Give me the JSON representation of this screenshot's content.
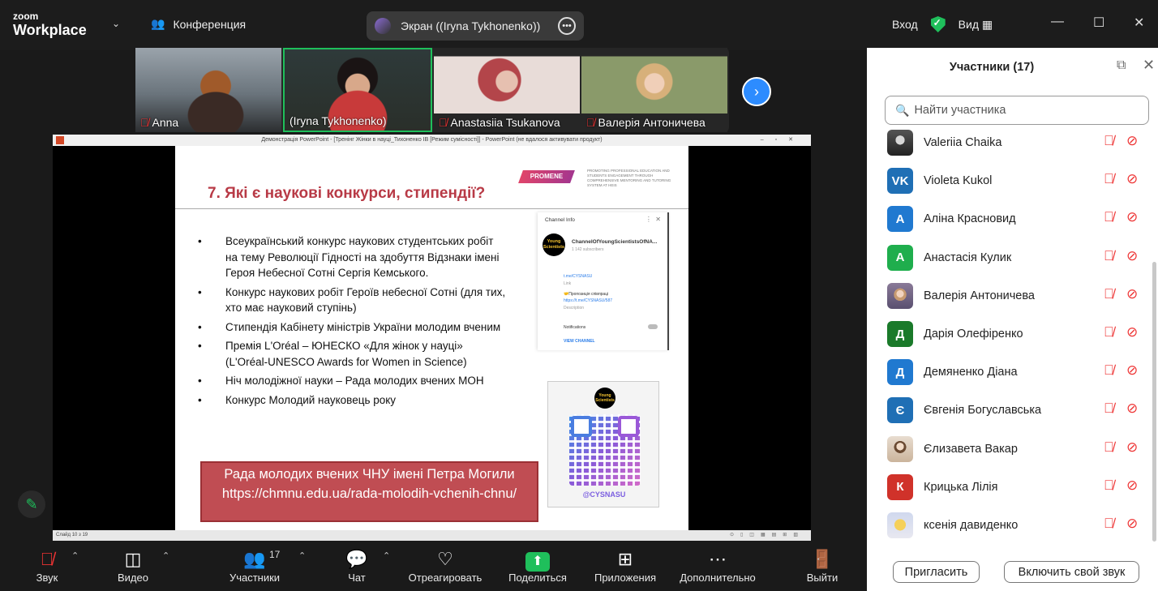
{
  "topbar": {
    "logo_line1": "zoom",
    "logo_line2": "Workplace",
    "meeting_label": "Конференция",
    "share_label": "Экран ((Iryna Tykhonenko))",
    "login_label": "Вход",
    "view_label": "Вид",
    "accent_green": "#1fbf5b"
  },
  "video_tiles": [
    {
      "name": "Anna",
      "muted": true
    },
    {
      "name": "(Iryna Tykhonenko)",
      "muted": false,
      "active": true
    },
    {
      "name": "Anastasiia Tsukanova",
      "muted": true
    },
    {
      "name": "Валерія Антоничева",
      "muted": true
    }
  ],
  "ppt": {
    "window_title": "Демонстрація PowerPoint - [Тренінг Жінки в науці_Тихоненко ІВ [Режим сумісності]] - PowerPoint (не вдалося активувати продукт)",
    "status_left": "Слайд 10 з 19",
    "slide_title": "7. Які є наукові конкурси, стипендії?",
    "logo_text": "PROMENE",
    "promo_text": "PROMOTING PROFESSIONAL EDUCATION AND STUDENTS ENGAGEMENT THROUGH COMPREHENSIVE MENTORING AND TUTORING SYSTEM AT HEIS",
    "bullets": [
      "Всеукраїнський конкурс наукових студентських робіт на тему Революції Гідності на здобуття Відзнаки імені Героя Небесної Сотні Сергія Кемського.",
      "Конкурс наукових робіт Героїв небесної Сотні (для тих, хто має науковий ступінь)",
      "Стипендія Кабінету міністрів України молодим вченим",
      "Премія L'Oréal – ЮНЕСКО «Для жінок у науці» (L'Oréal-UNESCO Awards for Women in Science)",
      "Ніч молодіжної науки – Рада молодих вчених МОН",
      "Конкурс Молодий науковець року"
    ],
    "rada_text": "Рада молодих вчених ЧНУ імені Петра Могили https://chmnu.edu.ua/rada-molodih-vchenih-chnu/",
    "channel": {
      "header": "Channel Info",
      "avatar_text": "Young Scientists",
      "name": "ChannelOfYoungScientistsOfNA...",
      "subscribers": "1 142 subscribers",
      "link": "t.me/CYSNASU",
      "link_label": "Link",
      "desc_line1": "🤝Пропозиція співпраці",
      "desc_line2": "https://t.me/CYSNASU/587",
      "desc_label": "Description",
      "notifications": "Notifications",
      "view_channel": "VIEW CHANNEL"
    },
    "qr_badge": "Young Scientists",
    "qr_caption": "@CYSNASU"
  },
  "toolbar": {
    "audio": "Звук",
    "video": "Видео",
    "participants": "Участники",
    "participants_count": "17",
    "chat": "Чат",
    "react": "Отреагировать",
    "share": "Поделиться",
    "apps": "Приложения",
    "more": "Дополнительно",
    "leave": "Выйти"
  },
  "panel": {
    "title": "Участники (17)",
    "search_placeholder": "Найти участника",
    "invite_button": "Пригласить",
    "unmute_button": "Включить свой звук",
    "participants": [
      {
        "name": "Valeriia Chaika",
        "initials": "",
        "color": "#7a7a7a",
        "photo": true
      },
      {
        "name": "Violeta Kukol",
        "initials": "VK",
        "color": "#1f6fb5",
        "photo": false
      },
      {
        "name": "Аліна Красновид",
        "initials": "А",
        "color": "#2079d0",
        "photo": false
      },
      {
        "name": "Анастасія Кулик",
        "initials": "А",
        "color": "#1fae4d",
        "photo": false
      },
      {
        "name": "Валерія Антоничева",
        "initials": "",
        "color": "#9a8ca0",
        "photo": true
      },
      {
        "name": "Дарія Олефіренко",
        "initials": "Д",
        "color": "#1a7a2a",
        "photo": false
      },
      {
        "name": "Демяненко Діана",
        "initials": "Д",
        "color": "#2079d0",
        "photo": false
      },
      {
        "name": "Євгенія Богуславська",
        "initials": "Є",
        "color": "#1f6fb5",
        "photo": false
      },
      {
        "name": "Єлизавета Вакар",
        "initials": "",
        "color": "#d8c4b0",
        "photo": true
      },
      {
        "name": "Крицька Лілія",
        "initials": "К",
        "color": "#d0322a",
        "photo": false
      },
      {
        "name": "ксенія давиденко",
        "initials": "",
        "color": "#e9c24a",
        "photo": true
      }
    ]
  }
}
